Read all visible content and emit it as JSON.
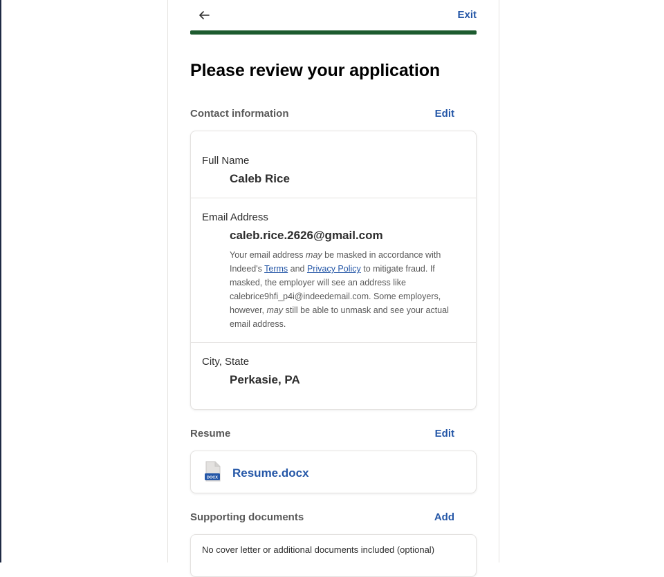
{
  "header": {
    "back_label": "←",
    "exit_label": "Exit",
    "progress_percent": 100,
    "progress_color": "#1d5b2f"
  },
  "page": {
    "title": "Please review your application"
  },
  "contact": {
    "section_title": "Contact information",
    "edit_label": "Edit",
    "full_name_label": "Full Name",
    "full_name": "Caleb Rice",
    "email_label": "Email Address",
    "email": "caleb.rice.2626@gmail.com",
    "email_note": {
      "p1": "Your email address ",
      "may1": "may",
      "p2": " be masked in accordance with Indeed's ",
      "terms": "Terms",
      "and": " and ",
      "privacy": "Privacy Policy",
      "p3": " to mitigate fraud. If masked, the employer will see an address like calebrice9hfi_p4i@indeedemail.com. Some employers, however, ",
      "may2": "may",
      "p4": " still be able to unmask and see your actual email address."
    },
    "city_label": "City, State",
    "city": "Perkasie, PA"
  },
  "resume": {
    "section_title": "Resume",
    "edit_label": "Edit",
    "file_icon": "docx-file-icon",
    "file_badge": "DOCX",
    "file_name": "Resume.docx"
  },
  "supporting": {
    "section_title": "Supporting documents",
    "add_label": "Add",
    "empty_text": "No cover letter or additional documents included (optional)"
  },
  "colors": {
    "link": "#2557a7",
    "progress": "#1d5b2f",
    "text": "#2d2d2d",
    "muted": "#595959"
  }
}
